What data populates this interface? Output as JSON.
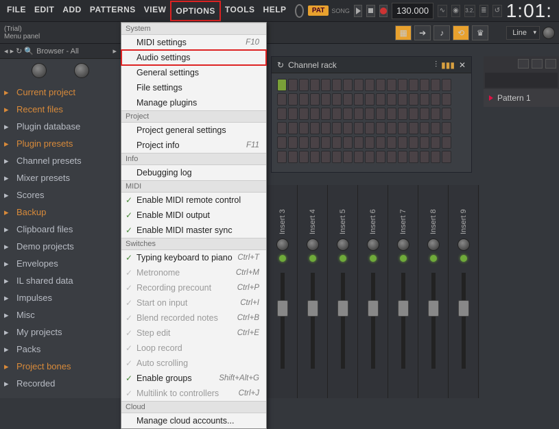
{
  "menubar": [
    "FILE",
    "EDIT",
    "ADD",
    "PATTERNS",
    "VIEW",
    "OPTIONS",
    "TOOLS",
    "HELP"
  ],
  "pat_badge": "PAT",
  "song_label": "SONG",
  "tempo": "130.000",
  "top_icons": [
    "wave",
    "midi",
    "3.2.1",
    "bar",
    "undo"
  ],
  "time_display": "1:01:",
  "hint": {
    "line1": "(Trial)",
    "line2": "Menu panel"
  },
  "snap_label": "Line",
  "browser": {
    "header": "Browser - All",
    "items": [
      {
        "label": "Current project",
        "cls": "orange"
      },
      {
        "label": "Recent files",
        "cls": "orange"
      },
      {
        "label": "Plugin database",
        "cls": ""
      },
      {
        "label": "Plugin presets",
        "cls": "orange"
      },
      {
        "label": "Channel presets",
        "cls": ""
      },
      {
        "label": "Mixer presets",
        "cls": ""
      },
      {
        "label": "Scores",
        "cls": ""
      },
      {
        "label": "Backup",
        "cls": "orange"
      },
      {
        "label": "Clipboard files",
        "cls": ""
      },
      {
        "label": "Demo projects",
        "cls": ""
      },
      {
        "label": "Envelopes",
        "cls": ""
      },
      {
        "label": "IL shared data",
        "cls": ""
      },
      {
        "label": "Impulses",
        "cls": ""
      },
      {
        "label": "Misc",
        "cls": ""
      },
      {
        "label": "My projects",
        "cls": ""
      },
      {
        "label": "Packs",
        "cls": ""
      },
      {
        "label": "Project bones",
        "cls": "orange"
      },
      {
        "label": "Recorded",
        "cls": ""
      }
    ]
  },
  "channel_rack": {
    "title": "Channel rack"
  },
  "mixer_inserts": [
    "Insert 3",
    "Insert 4",
    "Insert 5",
    "Insert 6",
    "Insert 7",
    "Insert 8",
    "Insert 9"
  ],
  "pattern": {
    "label": "Pattern 1"
  },
  "dropdown": {
    "sections": [
      {
        "title": "System",
        "items": [
          {
            "label": "MIDI settings",
            "shortcut": "F10"
          },
          {
            "label": "Audio settings",
            "hl": true
          },
          {
            "label": "General settings"
          },
          {
            "label": "File settings"
          },
          {
            "label": "Manage plugins"
          }
        ]
      },
      {
        "title": "Project",
        "items": [
          {
            "label": "Project general settings"
          },
          {
            "label": "Project info",
            "shortcut": "F11"
          }
        ]
      },
      {
        "title": "Info",
        "items": [
          {
            "label": "Debugging log"
          }
        ]
      },
      {
        "title": "MIDI",
        "items": [
          {
            "label": "Enable MIDI remote control",
            "check": true
          },
          {
            "label": "Enable MIDI output",
            "check": true
          },
          {
            "label": "Enable MIDI master sync",
            "check": true
          }
        ]
      },
      {
        "title": "Switches",
        "items": [
          {
            "label": "Typing keyboard to piano",
            "shortcut": "Ctrl+T",
            "check": true
          },
          {
            "label": "Metronome",
            "shortcut": "Ctrl+M",
            "check": true,
            "grey": true
          },
          {
            "label": "Recording precount",
            "shortcut": "Ctrl+P",
            "check": true,
            "grey": true
          },
          {
            "label": "Start on input",
            "shortcut": "Ctrl+I",
            "check": true,
            "grey": true
          },
          {
            "label": "Blend recorded notes",
            "shortcut": "Ctrl+B",
            "check": true,
            "grey": true
          },
          {
            "label": "Step edit",
            "shortcut": "Ctrl+E",
            "check": true,
            "grey": true
          },
          {
            "label": "Loop record",
            "check": true,
            "grey": true
          },
          {
            "label": "Auto scrolling",
            "check": true,
            "grey": true
          },
          {
            "label": "Enable groups",
            "shortcut": "Shift+Alt+G",
            "check": true
          },
          {
            "label": "Multilink to controllers",
            "shortcut": "Ctrl+J",
            "check": true,
            "grey": true
          }
        ]
      },
      {
        "title": "Cloud",
        "items": [
          {
            "label": "Manage cloud accounts..."
          }
        ]
      }
    ]
  }
}
